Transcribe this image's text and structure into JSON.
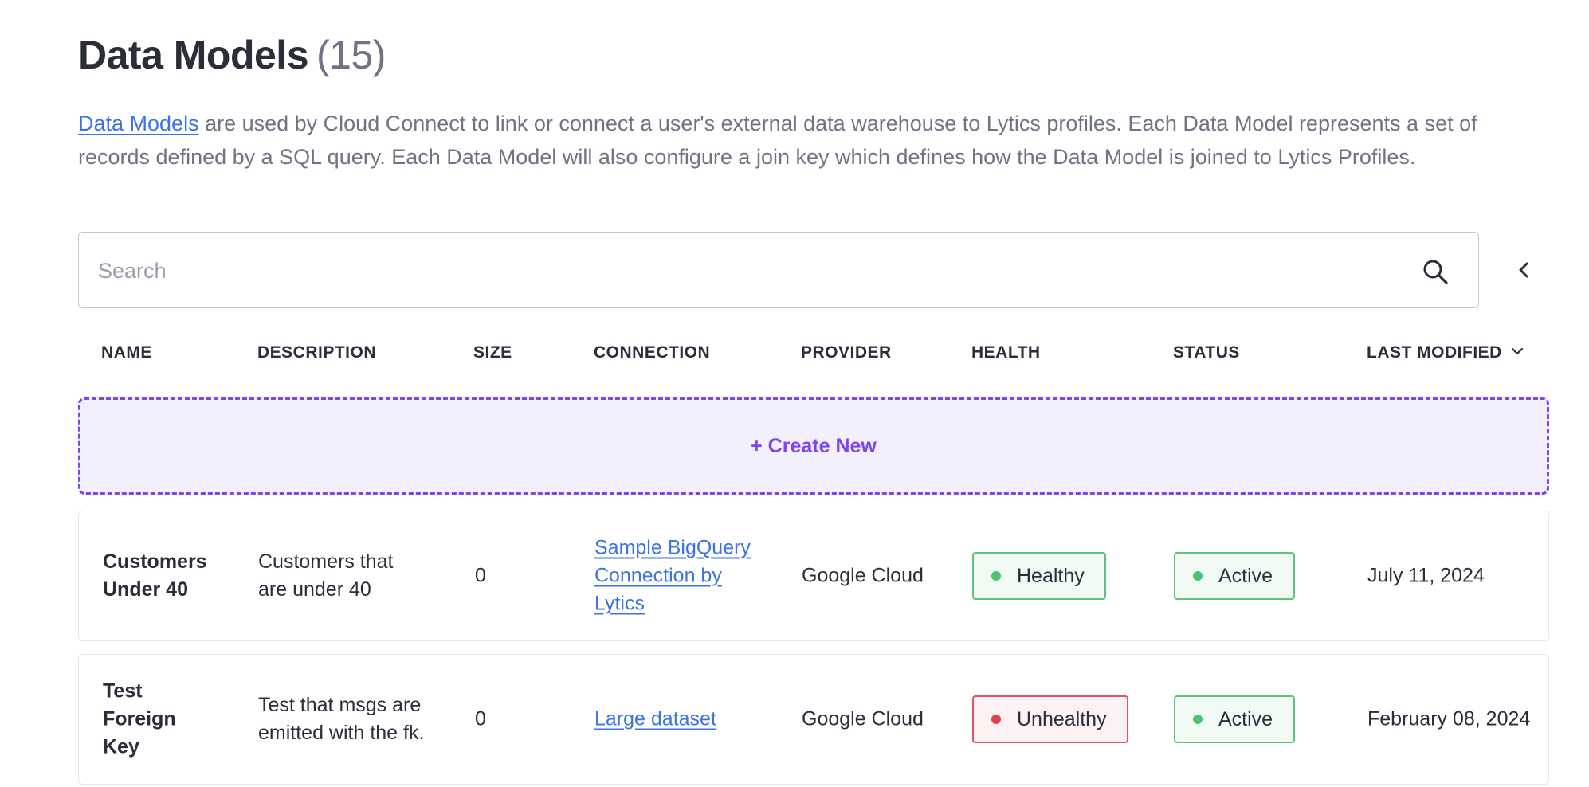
{
  "page": {
    "title": "Data Models",
    "count": "(15)",
    "intro_link": "Data Models",
    "intro_text": " are used by Cloud Connect to link or connect a user's external data warehouse to Lytics profiles. Each Data Model represents a set of records defined by a SQL query. Each Data Model will also configure a join key which defines how the Data Model is joined to Lytics Profiles."
  },
  "search": {
    "placeholder": "Search",
    "value": ""
  },
  "icons": {
    "search": "search-icon",
    "collapse": "chevron-left-icon",
    "sort": "chevron-down-icon"
  },
  "table": {
    "columns": [
      "NAME",
      "DESCRIPTION",
      "SIZE",
      "CONNECTION",
      "PROVIDER",
      "HEALTH",
      "STATUS",
      "LAST MODIFIED"
    ],
    "sorted_by": "LAST MODIFIED",
    "create_label": "+ Create New",
    "rows": [
      {
        "name": "Customers Under 40",
        "description": "Customers that are under 40",
        "size": "0",
        "connection": "Sample BigQuery Connection by Lytics",
        "provider": "Google Cloud",
        "health": "Healthy",
        "status": "Active",
        "last_modified": "July 11, 2024"
      },
      {
        "name": "Test Foreign Key",
        "description": "Test that msgs are emitted with the fk.",
        "size": "0",
        "connection": "Large dataset",
        "provider": "Google Cloud",
        "health": "Unhealthy",
        "status": "Active",
        "last_modified": "February 08, 2024"
      }
    ]
  },
  "colors": {
    "accent": "#7c45f0",
    "link": "#3b72e5",
    "healthy": "#4cc36e",
    "unhealthy": "#e0404f"
  }
}
